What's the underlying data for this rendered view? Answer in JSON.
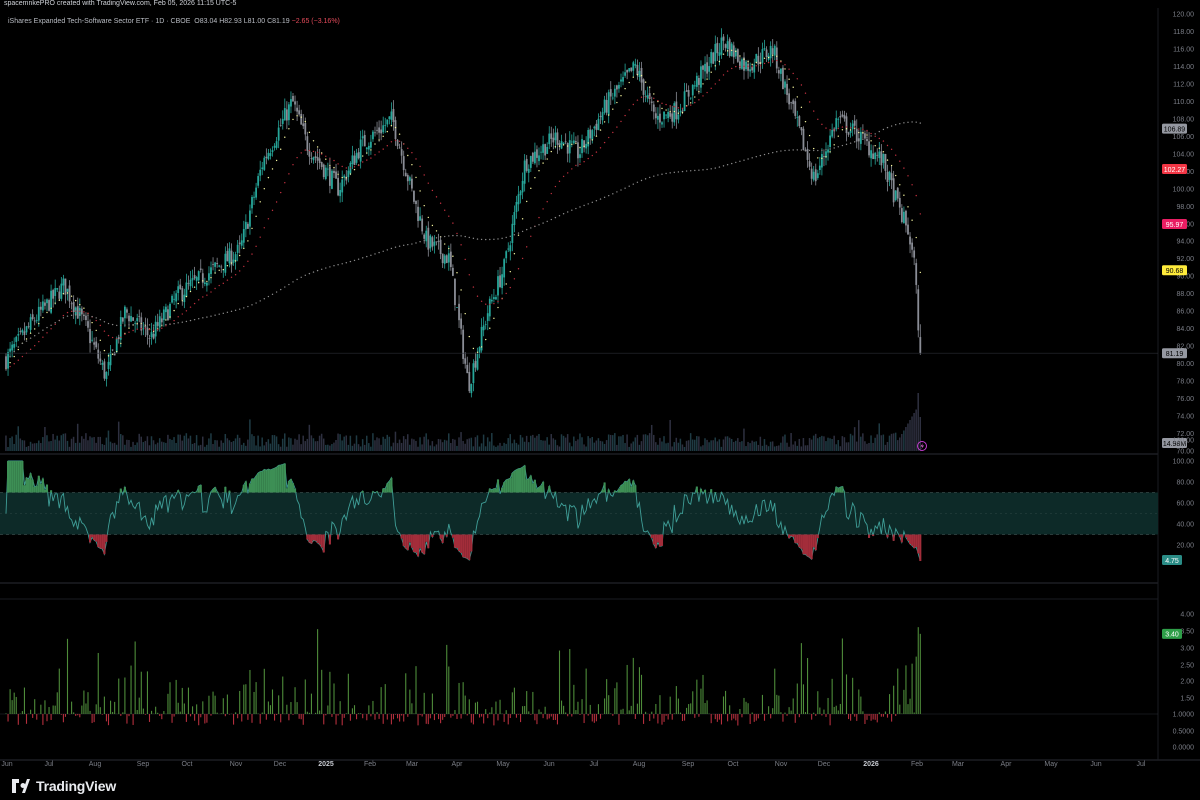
{
  "header": {
    "created_by": "spacemnkePRO created with TradingView.com, Feb 05, 2026 11:15 UTC-5"
  },
  "symbol": {
    "name": "iShares Expanded Tech-Software Sector ETF",
    "interval": "1D",
    "exchange": "CBOE",
    "open": "O83.04",
    "high": "H82.93",
    "low": "L81.00",
    "close": "C81.19",
    "change": "−2.65 (−3.16%)"
  },
  "brand": {
    "name": "TradingView"
  },
  "colors": {
    "background": "#000000",
    "up": "#26a69a",
    "down": "#8a8d96",
    "ema_fast": "#f7f7a0",
    "ema_mid": "#c0303f",
    "sma_slow": "#8c8c8c",
    "rsi_line": "#3f9e97",
    "rsi_band": "#0d2a28",
    "osc_up": "#4e8c3a",
    "osc_down": "#b52f3d",
    "label_gray": "#9598a1",
    "label_red": "#f23645",
    "label_pink": "#e91e63",
    "label_yellow": "#ffeb3b",
    "label_teal": "#2a8c86",
    "label_green": "#2e9e48"
  },
  "chart_data": [
    {
      "type": "candlestick",
      "panel": "price",
      "ylim": [
        70,
        120
      ],
      "y_ticks": [
        "70.00",
        "72.00",
        "74.00",
        "76.00",
        "78.00",
        "80.00",
        "82.00",
        "84.00",
        "86.00",
        "88.00",
        "90.00",
        "92.00",
        "94.00",
        "96.00",
        "98.00",
        "100.00",
        "102.00",
        "104.00",
        "106.00",
        "108.00",
        "110.00",
        "112.00",
        "114.00",
        "116.00",
        "118.00",
        "120.00"
      ],
      "x_ticks": [
        "Jun",
        "Jul",
        "Aug",
        "Sep",
        "Oct",
        "Nov",
        "Dec",
        "2025",
        "Feb",
        "Mar",
        "Apr",
        "May",
        "Jun",
        "Jul",
        "Aug",
        "Sep",
        "Oct",
        "Nov",
        "Dec",
        "2026",
        "Feb",
        "Mar",
        "Apr",
        "May",
        "Jun",
        "Jul"
      ],
      "price_anchors": [
        [
          "2024-06-01",
          80.5
        ],
        [
          "2024-06-20",
          85
        ],
        [
          "2024-07-10",
          89
        ],
        [
          "2024-07-25",
          84
        ],
        [
          "2024-08-07",
          78.5
        ],
        [
          "2024-08-20",
          86
        ],
        [
          "2024-09-06",
          83
        ],
        [
          "2024-09-25",
          88
        ],
        [
          "2024-10-20",
          91
        ],
        [
          "2024-11-05",
          93
        ],
        [
          "2024-11-20",
          103
        ],
        [
          "2024-12-10",
          110
        ],
        [
          "2024-12-20",
          105
        ],
        [
          "2025-01-10",
          100
        ],
        [
          "2025-01-25",
          105
        ],
        [
          "2025-02-15",
          108
        ],
        [
          "2025-03-01",
          99
        ],
        [
          "2025-03-10",
          94
        ],
        [
          "2025-03-25",
          92
        ],
        [
          "2025-04-07",
          77.5
        ],
        [
          "2025-04-20",
          86
        ],
        [
          "2025-05-01",
          91
        ],
        [
          "2025-05-15",
          103
        ],
        [
          "2025-06-05",
          106
        ],
        [
          "2025-06-20",
          104
        ],
        [
          "2025-07-10",
          110
        ],
        [
          "2025-07-28",
          114
        ],
        [
          "2025-08-10",
          108
        ],
        [
          "2025-08-25",
          109
        ],
        [
          "2025-09-10",
          113
        ],
        [
          "2025-09-25",
          117
        ],
        [
          "2025-10-10",
          114
        ],
        [
          "2025-10-28",
          116
        ],
        [
          "2025-11-10",
          109
        ],
        [
          "2025-11-25",
          101
        ],
        [
          "2025-12-10",
          108
        ],
        [
          "2025-12-25",
          106
        ],
        [
          "2026-01-10",
          103
        ],
        [
          "2026-01-20",
          98
        ],
        [
          "2026-01-27",
          95
        ],
        [
          "2026-02-02",
          89
        ],
        [
          "2026-02-05",
          81.19
        ]
      ],
      "overlays": [
        {
          "name": "",
          "style": "dotted",
          "color": "ema_fast",
          "period": 10
        },
        {
          "name": "",
          "style": "dotted",
          "color": "ema_mid",
          "period": 30
        },
        {
          "name": "",
          "style": "dotted",
          "color": "sma_slow",
          "period": 200
        }
      ],
      "price_labels": [
        {
          "text": "106.89",
          "value": 106.89,
          "color": "label_gray"
        },
        {
          "text": "102.27",
          "value": 102.27,
          "color": "label_red"
        },
        {
          "text": "95.97",
          "value": 95.97,
          "color": "label_pink"
        },
        {
          "text": "90.68",
          "value": 90.68,
          "color": "label_yellow"
        },
        {
          "text": "81.19",
          "value": 81.19,
          "color": "label_gray"
        }
      ],
      "volume_label": {
        "text": "14.98M",
        "color": "label_gray"
      }
    },
    {
      "type": "line",
      "panel": "rsi",
      "ylim": [
        0,
        120
      ],
      "y_ticks": [
        "20.00",
        "40.00",
        "60.00",
        "80.00",
        "100.00",
        "120.00"
      ],
      "band": [
        30,
        70
      ],
      "midline": 50,
      "last_label": {
        "text": "4.75",
        "value": 4.75,
        "color": "label_teal"
      }
    },
    {
      "type": "bar",
      "panel": "ratio",
      "baseline": 1,
      "y_ticks": [
        "0.0000",
        "0.5000",
        "1.0000",
        "1.50",
        "2.00",
        "2.50",
        "3.00",
        "3.50",
        "4.00"
      ],
      "last_label": {
        "text": "3.40",
        "value": 3.4,
        "color": "label_green"
      }
    }
  ]
}
